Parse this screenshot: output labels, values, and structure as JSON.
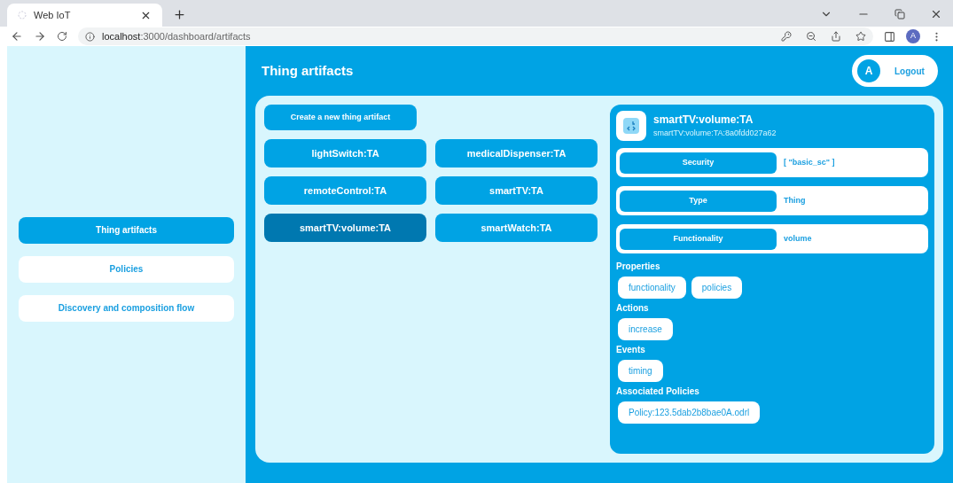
{
  "browser": {
    "tab_title": "Web IoT",
    "url_host": "localhost",
    "url_path": ":3000/dashboard/artifacts",
    "profile_initial": "A"
  },
  "sidebar": {
    "items": [
      {
        "label": "Thing artifacts",
        "selected": true
      },
      {
        "label": "Policies",
        "selected": false
      },
      {
        "label": "Discovery and composition flow",
        "selected": false
      }
    ]
  },
  "header": {
    "title": "Thing artifacts",
    "user_initial": "A",
    "logout": "Logout"
  },
  "artifacts": {
    "create_button": "Create a new thing artifact",
    "items": [
      {
        "label": "lightSwitch:TA",
        "selected": false
      },
      {
        "label": "medicalDispenser:TA",
        "selected": false
      },
      {
        "label": "remoteControl:TA",
        "selected": false
      },
      {
        "label": "smartTV:TA",
        "selected": false
      },
      {
        "label": "smartTV:volume:TA",
        "selected": true
      },
      {
        "label": "smartWatch:TA",
        "selected": false
      }
    ]
  },
  "detail": {
    "title": "smartTV:volume:TA",
    "id": "smartTV:volume:TA:8a0fdd027a62",
    "fields": [
      {
        "label": "Security",
        "value": "[ \"basic_sc\" ]"
      },
      {
        "label": "Type",
        "value": "Thing"
      },
      {
        "label": "Functionality",
        "value": "volume"
      }
    ],
    "sections": [
      {
        "heading": "Properties",
        "chips": [
          "functionality",
          "policies"
        ]
      },
      {
        "heading": "Actions",
        "chips": [
          "increase"
        ]
      },
      {
        "heading": "Events",
        "chips": [
          "timing"
        ]
      },
      {
        "heading": "Associated Policies",
        "chips": [
          "Policy:123.5dab2b8bae0A.odrl"
        ]
      }
    ]
  }
}
